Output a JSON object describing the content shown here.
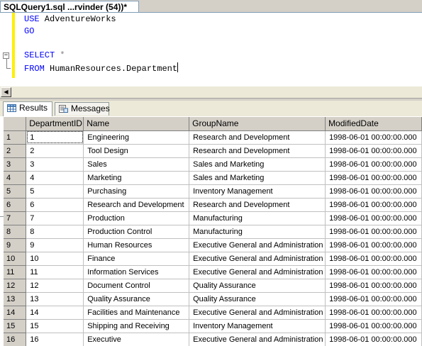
{
  "tab": {
    "title": "SQLQuery1.sql ...rvinder (54))*"
  },
  "editor": {
    "lines": [
      {
        "keyword": "USE",
        "rest": " AdventureWorks"
      },
      {
        "keyword": "GO",
        "rest": ""
      },
      {
        "keyword": "",
        "rest": ""
      },
      {
        "keyword": "SELECT",
        "op": " *"
      },
      {
        "keyword": "FROM",
        "rest": " HumanResources.Department"
      }
    ],
    "collapse_glyph": "−"
  },
  "scrollbar": {
    "left_arrow": "◀"
  },
  "results_tabs": [
    {
      "label": "Results",
      "icon": "grid-icon",
      "active": true
    },
    {
      "label": "Messages",
      "icon": "messages-icon",
      "active": false
    }
  ],
  "grid": {
    "columns": [
      "DepartmentID",
      "Name",
      "GroupName",
      "ModifiedDate"
    ],
    "rows": [
      [
        "1",
        "1",
        "Engineering",
        "Research and Development",
        "1998-06-01 00:00:00.000"
      ],
      [
        "2",
        "2",
        "Tool Design",
        "Research and Development",
        "1998-06-01 00:00:00.000"
      ],
      [
        "3",
        "3",
        "Sales",
        "Sales and Marketing",
        "1998-06-01 00:00:00.000"
      ],
      [
        "4",
        "4",
        "Marketing",
        "Sales and Marketing",
        "1998-06-01 00:00:00.000"
      ],
      [
        "5",
        "5",
        "Purchasing",
        "Inventory Management",
        "1998-06-01 00:00:00.000"
      ],
      [
        "6",
        "6",
        "Research and Development",
        "Research and Development",
        "1998-06-01 00:00:00.000"
      ],
      [
        "7",
        "7",
        "Production",
        "Manufacturing",
        "1998-06-01 00:00:00.000"
      ],
      [
        "8",
        "8",
        "Production Control",
        "Manufacturing",
        "1998-06-01 00:00:00.000"
      ],
      [
        "9",
        "9",
        "Human Resources",
        "Executive General and Administration",
        "1998-06-01 00:00:00.000"
      ],
      [
        "10",
        "10",
        "Finance",
        "Executive General and Administration",
        "1998-06-01 00:00:00.000"
      ],
      [
        "11",
        "11",
        "Information Services",
        "Executive General and Administration",
        "1998-06-01 00:00:00.000"
      ],
      [
        "12",
        "12",
        "Document Control",
        "Quality Assurance",
        "1998-06-01 00:00:00.000"
      ],
      [
        "13",
        "13",
        "Quality Assurance",
        "Quality Assurance",
        "1998-06-01 00:00:00.000"
      ],
      [
        "14",
        "14",
        "Facilities and Maintenance",
        "Executive General and Administration",
        "1998-06-01 00:00:00.000"
      ],
      [
        "15",
        "15",
        "Shipping and Receiving",
        "Inventory Management",
        "1998-06-01 00:00:00.000"
      ],
      [
        "16",
        "16",
        "Executive",
        "Executive General and Administration",
        "1998-06-01 00:00:00.000"
      ]
    ]
  },
  "colors": {
    "keyword": "#0000ff",
    "operator": "#808080",
    "change_bar": "#ffef00",
    "header_bg": "#d4d0c8"
  }
}
